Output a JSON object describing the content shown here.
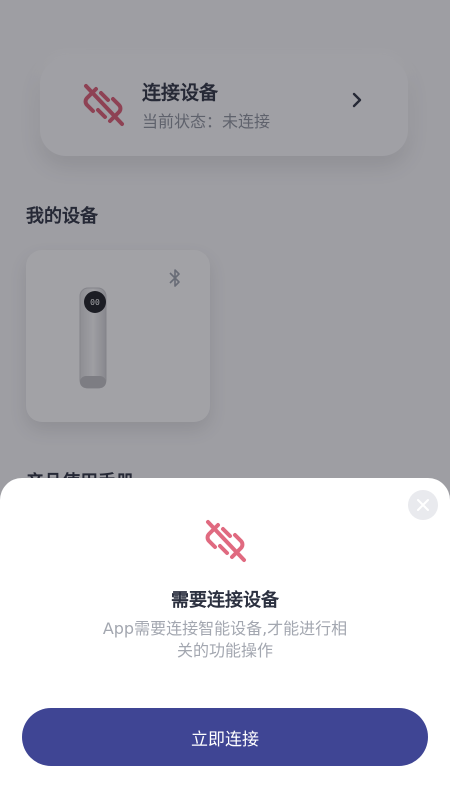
{
  "connect_card": {
    "title": "连接设备",
    "status": "当前状态：未连接"
  },
  "my_devices": {
    "title": "我的设备"
  },
  "manual": {
    "title": "产品使用手册"
  },
  "dialog": {
    "title": "需要连接设备",
    "description": "App需要连接智能设备,才能进行相关的功能操作",
    "button_label": "立即连接"
  },
  "colors": {
    "accent": "#3f4594",
    "link_icon": "#e06a80"
  }
}
